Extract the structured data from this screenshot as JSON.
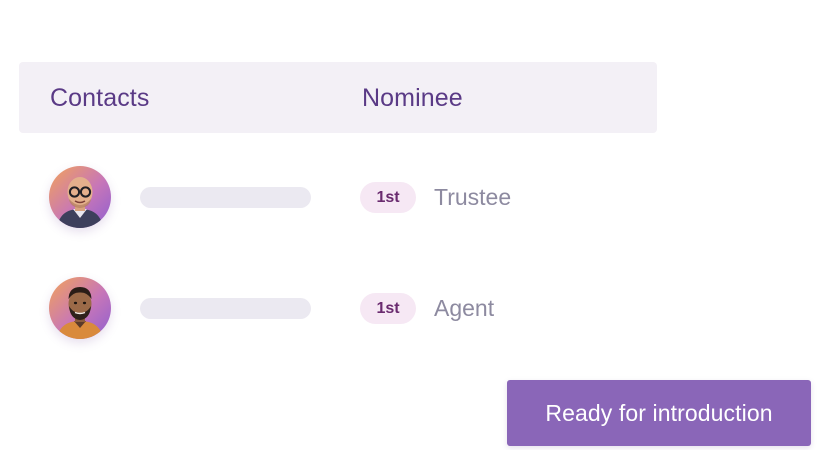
{
  "table": {
    "columns": {
      "contacts": "Contacts",
      "nominee": "Nominee"
    },
    "rows": [
      {
        "avatar": "avatar-photo-bald-glasses-man",
        "rank": "1st",
        "role": "Trustee"
      },
      {
        "avatar": "avatar-photo-bearded-man",
        "rank": "1st",
        "role": "Agent"
      }
    ]
  },
  "cta": {
    "label": "Ready for introduction"
  },
  "colors": {
    "accent": "#8a66b8",
    "header_bg": "#f3f0f6",
    "header_text": "#5a3a86",
    "badge_bg": "#f6e8f4",
    "badge_text": "#6a2b6f",
    "muted_text": "#8d8aa0",
    "placeholder": "#ebe9f1"
  }
}
